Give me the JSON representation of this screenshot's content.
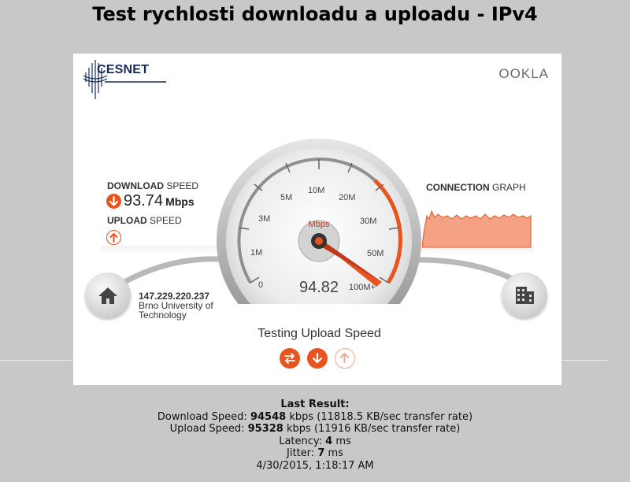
{
  "page": {
    "title": "Test rychlosti downloadu a uploadu - IPv4"
  },
  "brand": {
    "left_logo": "CESNET",
    "right_logo": "OOKLA"
  },
  "download": {
    "label_bold": "DOWNLOAD",
    "label_rest": "SPEED",
    "value": "93.74",
    "unit": "Mbps",
    "icon": "arrow-down-icon"
  },
  "upload": {
    "label_bold": "UPLOAD",
    "label_rest": "SPEED",
    "icon": "arrow-up-icon"
  },
  "connection": {
    "label_bold": "CONNECTION",
    "label_rest": "GRAPH",
    "graph_color": "#f4a184",
    "graph_line_color": "#e9531e"
  },
  "client": {
    "ip": "147.229.220.237",
    "org_line1": "Brno University of",
    "org_line2": "Technology",
    "icon": "home-icon"
  },
  "server": {
    "icon": "building-icon"
  },
  "gauge": {
    "unit": "Mbps",
    "readout": "94.82",
    "ticks": [
      "0",
      "1M",
      "3M",
      "5M",
      "10M",
      "20M",
      "30M",
      "50M",
      "100M+"
    ],
    "needle_value": "94.82",
    "accent": "#e9531e"
  },
  "status": {
    "text": "Testing Upload Speed"
  },
  "buttons": [
    {
      "icon": "swap-arrows-icon"
    },
    {
      "icon": "arrow-down-icon"
    },
    {
      "icon": "arrow-up-icon"
    }
  ],
  "last_result": {
    "heading": "Last Result:",
    "download_label": "Download Speed:",
    "download_value": "94548",
    "download_rest": "kbps (11818.5 KB/sec transfer rate)",
    "upload_label": "Upload Speed:",
    "upload_value": "95328",
    "upload_rest": "kbps (11916 KB/sec transfer rate)",
    "latency_label": "Latency:",
    "latency_value": "4",
    "latency_unit": "ms",
    "jitter_label": "Jitter:",
    "jitter_value": "7",
    "jitter_unit": "ms",
    "timestamp": "4/30/2015, 1:18:17 AM"
  }
}
